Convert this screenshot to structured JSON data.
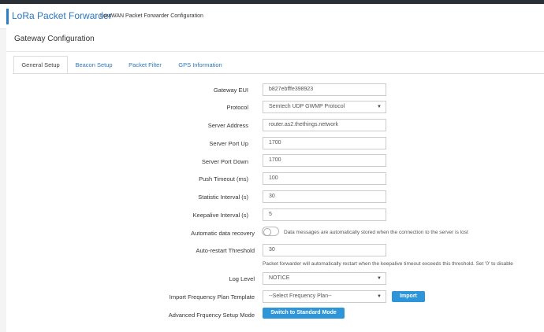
{
  "app": {
    "brand": "LoRa Packet Forwarder",
    "subtitle": "LoraWAN Packet Forwarder Configuration"
  },
  "page": {
    "title": "Gateway Configuration"
  },
  "tabs": [
    {
      "label": "General Setup",
      "active": true
    },
    {
      "label": "Beacon Setup"
    },
    {
      "label": "Packet Filter"
    },
    {
      "label": "GPS Information"
    }
  ],
  "form": {
    "gateway_eui": {
      "label": "Gateway EUI",
      "value": "b827ebfffe398923"
    },
    "protocol": {
      "label": "Protocol",
      "value": "Semtech UDP GWMP Protocol"
    },
    "server_address": {
      "label": "Server Address",
      "value": "router.as2.thethings.network"
    },
    "server_port_up": {
      "label": "Server Port Up",
      "value": "1700"
    },
    "server_port_down": {
      "label": "Server Port Down",
      "value": "1700"
    },
    "push_timeout": {
      "label": "Push Timeout (ms)",
      "value": "100"
    },
    "statistic_interval": {
      "label": "Statistic Interval (s)",
      "value": "30"
    },
    "keepalive_interval": {
      "label": "Keepalive Interval (s)",
      "value": "5"
    },
    "auto_recovery": {
      "label": "Automatic data recovery",
      "enabled": false,
      "help": "Data messages are automatically stored when the connection to the server is lost"
    },
    "auto_restart": {
      "label": "Auto-restart Threshold",
      "value": "30",
      "help": "Packet forwarder will automatically restart when the keepalive timeout exceeds this threshold. Set '0' to disable"
    },
    "log_level": {
      "label": "Log Level",
      "value": "NOTICE"
    },
    "freq_plan": {
      "label": "Import Frequency Plan Template",
      "value": "--Select Frequency Plan--",
      "button": "Import"
    },
    "advanced": {
      "label": "Advanced Frquency Setup Mode",
      "button": "Switch to Standard Mode"
    }
  },
  "colors": {
    "accent": "#2a78bd",
    "button": "#2e96d8",
    "topbar": "#2b2f36"
  }
}
